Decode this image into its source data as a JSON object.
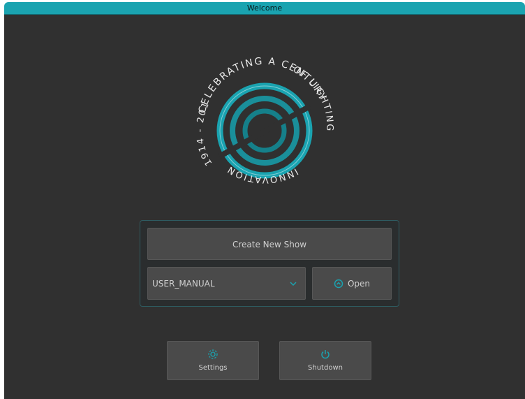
{
  "window": {
    "title": "Welcome"
  },
  "logo": {
    "top_text": "CELEBRATING A CENTURY",
    "right_text": "OF LIGHTING",
    "bottom_text": "INNOVATION",
    "left_text": "1914 - 2014"
  },
  "panel": {
    "create_label": "Create New Show",
    "show_select": {
      "selected": "USER_MANUAL"
    },
    "open_label": "Open"
  },
  "bottom": {
    "settings_label": "Settings",
    "shutdown_label": "Shutdown"
  },
  "colors": {
    "accent": "#1aa3b0",
    "background": "#303030",
    "button": "#4a4a4a"
  },
  "icons": {
    "settings": "gear-icon",
    "shutdown": "power-icon",
    "open": "open-icon",
    "dropdown": "chevron-down-icon"
  }
}
